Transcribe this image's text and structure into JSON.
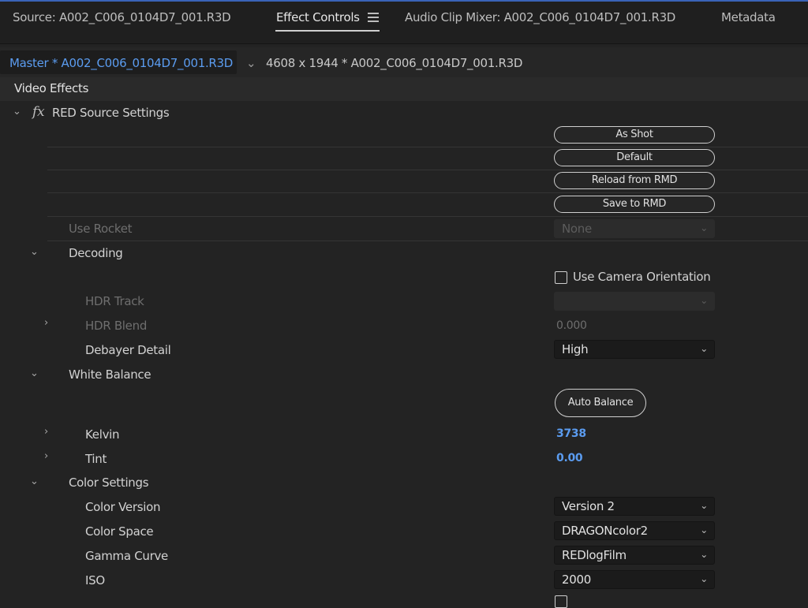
{
  "tabs": [
    {
      "label": "Source: A002_C006_0104D7_001.R3D"
    },
    {
      "label": "Effect Controls",
      "active": true
    },
    {
      "label": "Audio Clip Mixer: A002_C006_0104D7_001.R3D"
    },
    {
      "label": "Metadata"
    }
  ],
  "menu_icon": "hamburger-menu-icon",
  "clip_bar": {
    "master": "Master * A002_C006_0104D7_001.R3D",
    "sequence": "4608 x 1944 * A002_C006_0104D7_001.R3D"
  },
  "section_title": "Video Effects",
  "effect": {
    "fx_symbol": "fx",
    "name": "RED Source Settings",
    "buttons": [
      "As Shot",
      "Default",
      "Reload from RMD",
      "Save to RMD"
    ],
    "use_rocket": {
      "label": "Use Rocket",
      "value": "None"
    },
    "decoding": {
      "label": "Decoding",
      "use_camera_orientation": {
        "label": "Use Camera Orientation",
        "checked": false
      },
      "hdr_track": {
        "label": "HDR Track",
        "value": ""
      },
      "hdr_blend": {
        "label": "HDR Blend",
        "value": "0.000"
      },
      "debayer_detail": {
        "label": "Debayer Detail",
        "value": "High"
      }
    },
    "white_balance": {
      "label": "White Balance",
      "auto_balance": "Auto Balance",
      "kelvin": {
        "label": "Kelvin",
        "value": "3738"
      },
      "tint": {
        "label": "Tint",
        "value": "0.00"
      }
    },
    "color_settings": {
      "label": "Color Settings",
      "color_version": {
        "label": "Color Version",
        "value": "Version 2"
      },
      "color_space": {
        "label": "Color Space",
        "value": "DRAGONcolor2"
      },
      "gamma_curve": {
        "label": "Gamma Curve",
        "value": "REDlogFilm"
      },
      "iso": {
        "label": "ISO",
        "value": "2000"
      }
    }
  },
  "colors": {
    "accent_blue": "#5b9cf0",
    "panel_bg": "#232323",
    "text": "#cfcfcf"
  }
}
